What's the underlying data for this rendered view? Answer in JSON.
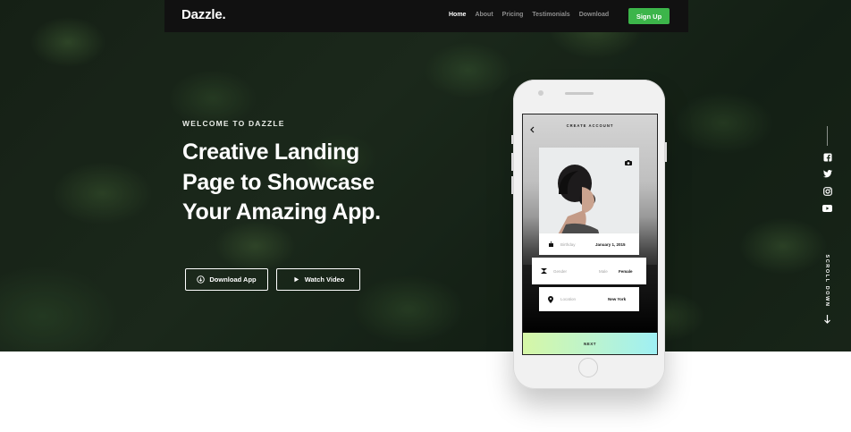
{
  "nav": {
    "logo": "Dazzle.",
    "links": [
      "Home",
      "About",
      "Pricing",
      "Testimonials",
      "Download"
    ],
    "signup_label": "Sign Up"
  },
  "hero": {
    "kicker": "WELCOME TO DAZZLE",
    "headline_lines": [
      "Creative Landing",
      "Page to Showcase",
      "Your Amazing App."
    ],
    "download_label": "Download App",
    "video_label": "Watch Video"
  },
  "social": {
    "icons": [
      "facebook-icon",
      "twitter-icon",
      "instagram-icon",
      "youtube-icon"
    ],
    "scroll_label": "SCROLL DOWN"
  },
  "phone": {
    "screen_title": "CREATE ACCOUNT",
    "birthday_label": "Birthday",
    "birthday_value": "January 1, 2015",
    "gender_label": "Gender",
    "gender_option_male": "Male",
    "gender_option_female": "Female",
    "location_label": "Location",
    "location_value": "New York",
    "next_label": "NEXT"
  },
  "colors": {
    "accent_green": "#3cb54a",
    "navbar_bg": "#111111"
  }
}
